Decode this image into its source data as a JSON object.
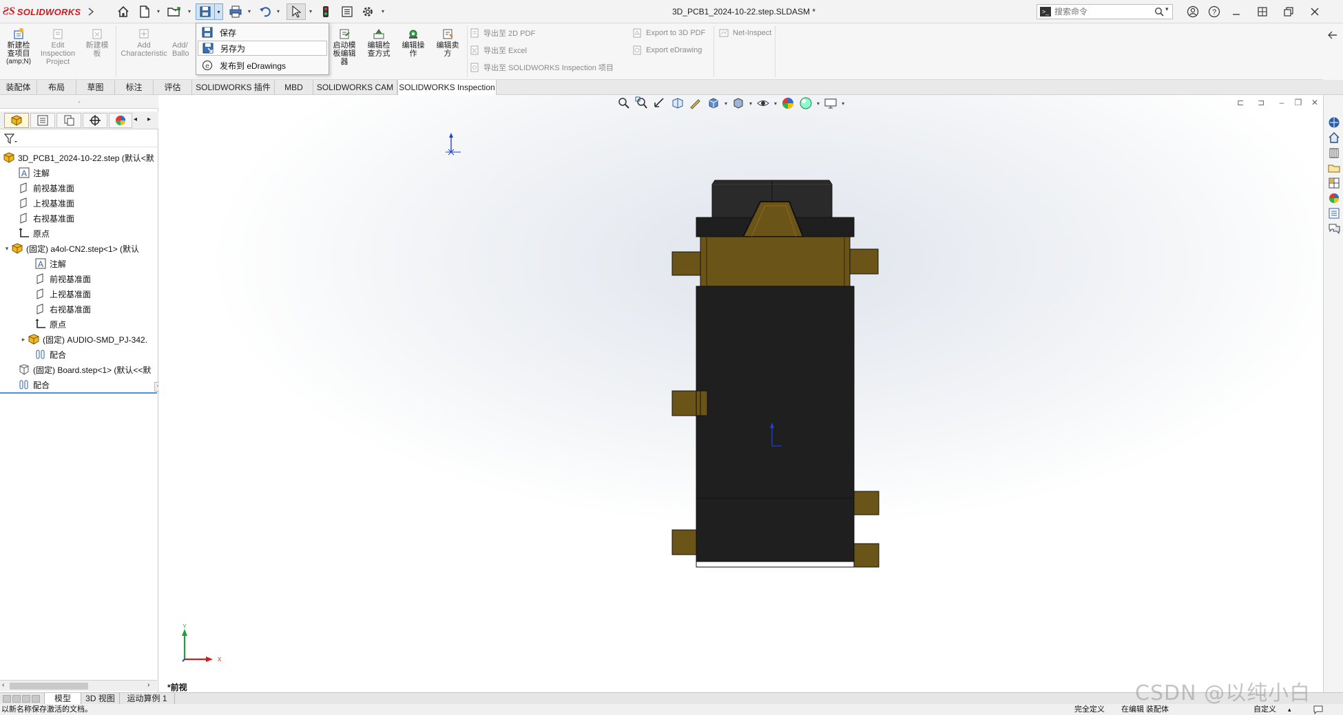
{
  "app": {
    "name": "SOLIDWORKS",
    "doc_title": "3D_PCB1_2024-10-22.step.SLDASM *"
  },
  "search": {
    "placeholder": "搜索命令"
  },
  "file_menu": {
    "items": [
      {
        "label": "保存",
        "icon": "save-icon"
      },
      {
        "label": "另存为",
        "icon": "save-as-icon"
      },
      {
        "label": "发布到 eDrawings",
        "icon": "edrawings-icon"
      }
    ]
  },
  "ribbon": {
    "new_inspection": {
      "line1": "新建检",
      "line2": "查项目",
      "line3": "(amp;N)"
    },
    "edit_project": {
      "line1": "Edit",
      "line2": "Inspection",
      "line3": "Project"
    },
    "new_template": {
      "line1": "新建模",
      "line2": "板"
    },
    "add_characteristic": {
      "line1": "Add",
      "line2": "Characteristic"
    },
    "add_balloon": {
      "line1": "Add/",
      "line2": "Ballo"
    },
    "launch_template_editor": {
      "line1": "启动模",
      "line2": "板编辑",
      "line3": "器"
    },
    "edit_inspection_method": {
      "line1": "编辑检",
      "line2": "查方式"
    },
    "edit_operation": {
      "line1": "编辑操",
      "line2": "作"
    },
    "edit_vendor": {
      "line1": "编辑卖",
      "line2": "方"
    },
    "export_2d_pdf": "导出至 2D PDF",
    "export_excel": "导出至 Excel",
    "export_inspection": "导出至 SOLIDWORKS Inspection 项目",
    "export_3d_pdf": "Export to 3D PDF",
    "export_edrawing": "Export eDrawing",
    "net_inspect": "Net-Inspect"
  },
  "tabs": [
    "装配体",
    "布局",
    "草图",
    "标注",
    "评估",
    "SOLIDWORKS 插件",
    "MBD",
    "SOLIDWORKS CAM",
    "SOLIDWORKS Inspection"
  ],
  "tree": {
    "root": "3D_PCB1_2024-10-22.step  (默认<默",
    "annotations": "注解",
    "front_plane": "前视基准面",
    "top_plane": "上视基准面",
    "right_plane": "右视基准面",
    "origin": "原点",
    "sub_assembly": "(固定) a4ol-CN2.step<1> (默认",
    "sub_annotations": "注解",
    "sub_front_plane": "前视基准面",
    "sub_top_plane": "上视基准面",
    "sub_right_plane": "右视基准面",
    "sub_origin": "原点",
    "audio_part": "(固定) AUDIO-SMD_PJ-342.",
    "sub_mates": "配合",
    "board": "(固定) Board.step<1> (默认<<默",
    "mates": "配合"
  },
  "graphics": {
    "view_label": "*前视",
    "triad_y": "Y",
    "triad_x": "X"
  },
  "model_tabs": [
    "模型",
    "3D 视图",
    "运动算例 1"
  ],
  "status": {
    "message": "以新名称保存激活的文档。",
    "definition": "完全定义",
    "editing": "在编辑 装配体",
    "units": "自定义"
  },
  "watermark": "CSDN @以纯小白",
  "colors": {
    "brand": "#d4181e",
    "part_black": "#1f1f1f",
    "part_gold": "#6b5418",
    "axis_blue": "#1f3fd6",
    "axis_red": "#d81b1b",
    "axis_green": "#1aa33a"
  }
}
